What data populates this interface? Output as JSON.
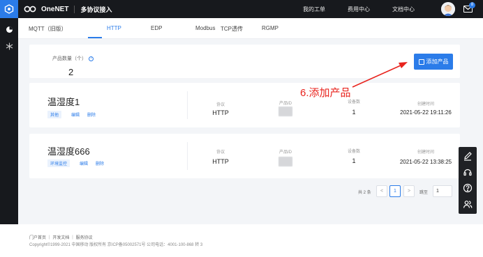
{
  "header": {
    "brand": "OneNET",
    "section_title": "多协议接入",
    "nav": [
      "我的工单",
      "费用中心",
      "文档中心"
    ],
    "mail_badge": "8"
  },
  "tabs": [
    {
      "label": "MQTT（旧版）",
      "active": false
    },
    {
      "label": "HTTP",
      "active": true
    },
    {
      "label": "EDP",
      "active": false
    },
    {
      "label": "Modbus",
      "active": false
    },
    {
      "label": "TCP透传",
      "active": false
    },
    {
      "label": "RGMP",
      "active": false
    }
  ],
  "summary": {
    "count_label": "产品数量（个）",
    "count_value": "2",
    "add_button_label": "添加产品"
  },
  "products": [
    {
      "name": "温湿度1",
      "tag": "其他",
      "actions": [
        "编辑",
        "删除"
      ],
      "protocol_label": "协议",
      "protocol": "HTTP",
      "id_label": "产品ID",
      "devices_label": "设备数",
      "devices": "1",
      "created_label": "创建时间",
      "created": "2021-05-22 19:11:26"
    },
    {
      "name": "温湿度666",
      "tag": "环境监控",
      "actions": [
        "编辑",
        "删除"
      ],
      "protocol_label": "协议",
      "protocol": "HTTP",
      "id_label": "产品ID",
      "devices_label": "设备数",
      "devices": "1",
      "created_label": "创建时间",
      "created": "2021-05-22 13:38:25"
    }
  ],
  "pagination": {
    "total": "共 2 条",
    "prev": "<",
    "current": "1",
    "next": ">",
    "jump_label": "跳至",
    "jump_value": "1"
  },
  "footer": {
    "links": "门户首页 ｜ 开发文档 ｜ 服务协议",
    "copyright": "Copyright©1999-2021 中国移动 版权所有 京ICP备05002571号 公司电话：4001-100-868 转 3"
  },
  "annotation": "6.添加产品",
  "colors": {
    "accent": "#2b7ce9",
    "topbar": "#17191d",
    "annotation": "#e8231d"
  }
}
